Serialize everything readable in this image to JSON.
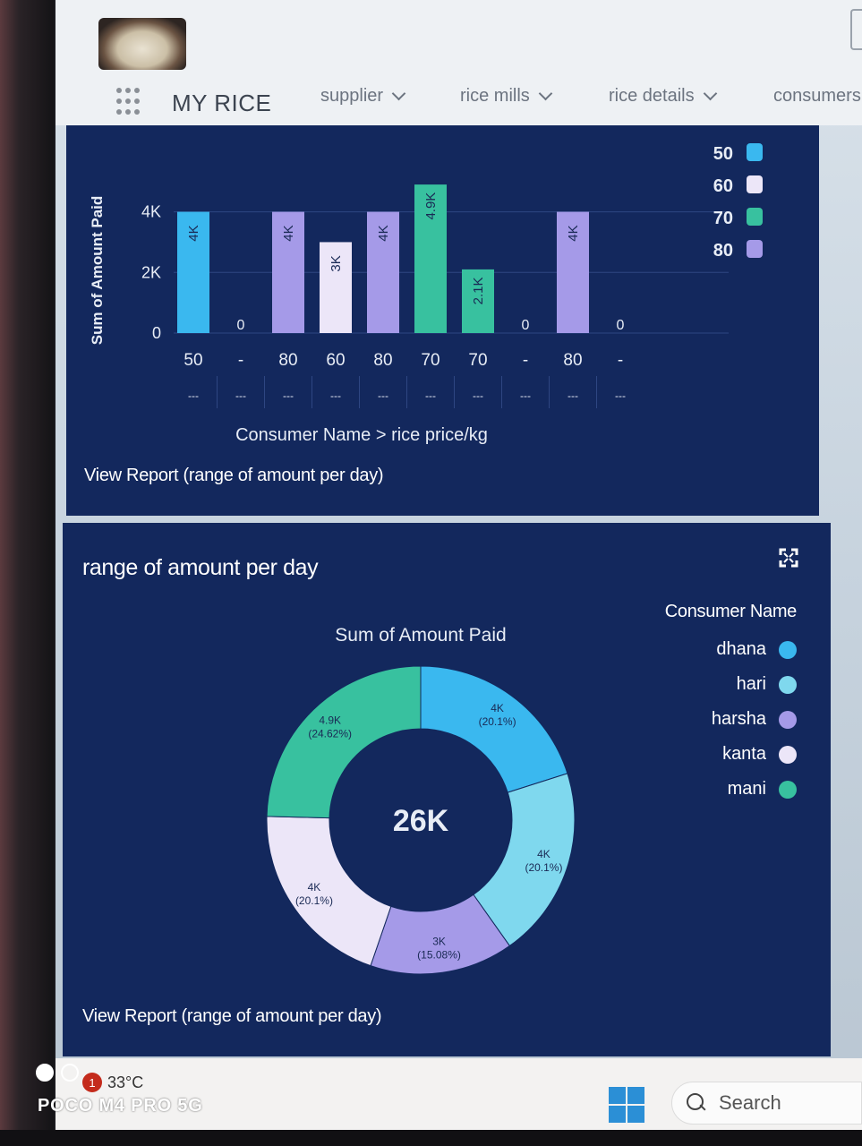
{
  "app": {
    "brand": "MY RICE",
    "nav": [
      {
        "label": "supplier"
      },
      {
        "label": "rice mills"
      },
      {
        "label": "rice details"
      },
      {
        "label": "consumers"
      }
    ]
  },
  "bar_panel": {
    "report_link": "View Report (range of amount per day)"
  },
  "pie_panel": {
    "title": "range of amount per day",
    "center_total": "26K",
    "report_link": "View Report (range of amount per day)"
  },
  "colors": {
    "panel_bg": "#13285d",
    "dhana": "#3ab8ef",
    "hari": "#7fd8ee",
    "harsha": "#a59ae8",
    "kanta": "#ece6f8",
    "mani": "#38c19f"
  },
  "chart_data": [
    {
      "type": "bar",
      "xlabel": "Consumer Name > rice price/kg",
      "ylabel": "Sum of Amount Paid",
      "ylim": [
        0,
        5500
      ],
      "yticks": [
        "0",
        "2K",
        "4K"
      ],
      "categories": [
        "50",
        "-",
        "80",
        "60",
        "80",
        "70",
        "70",
        "-",
        "80",
        "-"
      ],
      "sublabels": [
        "---",
        "---",
        "---",
        "---",
        "---",
        "---",
        "---",
        "---",
        "---",
        "---"
      ],
      "values": [
        4000,
        0,
        4000,
        3000,
        4000,
        4900,
        2100,
        0,
        4000,
        0
      ],
      "data_labels": [
        "4K",
        "0",
        "4K",
        "3K",
        "4K",
        "4.9K",
        "2.1K",
        "0",
        "4K",
        "0"
      ],
      "bar_colors": [
        "#3ab8ef",
        "#3ab8ef",
        "#a59ae8",
        "#ece6f8",
        "#a59ae8",
        "#38c19f",
        "#38c19f",
        "#38c19f",
        "#a59ae8",
        "#a59ae8"
      ],
      "legend": [
        {
          "label": "50",
          "color": "#3ab8ef"
        },
        {
          "label": "60",
          "color": "#ece6f8"
        },
        {
          "label": "70",
          "color": "#38c19f"
        },
        {
          "label": "80",
          "color": "#a59ae8"
        }
      ],
      "legend_position": "right",
      "grid": true
    },
    {
      "type": "pie",
      "donut": true,
      "title": "Sum of Amount Paid",
      "legend_title": "Consumer Name",
      "legend_position": "right",
      "slices": [
        {
          "name": "dhana",
          "value": 4000,
          "label": "4K",
          "pct": "(20.1%)",
          "color": "#3ab8ef"
        },
        {
          "name": "hari",
          "value": 4000,
          "label": "4K",
          "pct": "(20.1%)",
          "color": "#7fd8ee"
        },
        {
          "name": "harsha",
          "value": 3000,
          "label": "3K",
          "pct": "(15.08%)",
          "color": "#a59ae8"
        },
        {
          "name": "kanta",
          "value": 4000,
          "label": "4K",
          "pct": "(20.1%)",
          "color": "#ece6f8"
        },
        {
          "name": "mani",
          "value": 4900,
          "label": "4.9K",
          "pct": "(24.62%)",
          "color": "#38c19f"
        }
      ],
      "total": "26K"
    }
  ],
  "taskbar": {
    "temperature": "33°C",
    "notification_count": "1",
    "search_label": "Search"
  },
  "camera_watermark": "POCO M4 PRO 5G"
}
